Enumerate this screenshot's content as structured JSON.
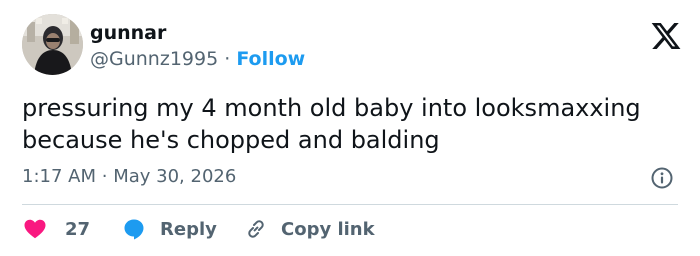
{
  "author": {
    "name": "gunnar",
    "handle": "@Gunnz1995",
    "separator": "·",
    "follow_label": "Follow"
  },
  "tweet": {
    "text": "pressuring my 4 month old baby into looksmaxxing because he's chopped and balding",
    "time": "1:17 AM",
    "date_separator": "·",
    "date": "May 30, 2026"
  },
  "actions": {
    "like_count": "27",
    "reply_label": "Reply",
    "copy_link_label": "Copy link"
  },
  "colors": {
    "accent": "#1d9bf0",
    "like": "#f91880",
    "text": "#0f1419",
    "muted": "#536471",
    "divider": "#cfd9de"
  },
  "icons": [
    "x-logo-icon",
    "info-icon",
    "heart-icon",
    "reply-bubble-icon",
    "link-icon"
  ]
}
